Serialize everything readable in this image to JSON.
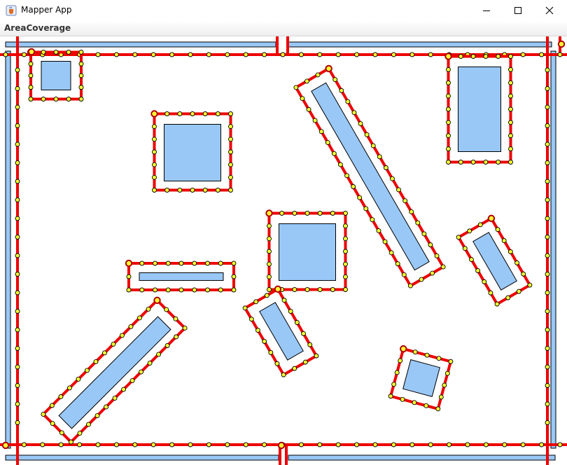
{
  "window": {
    "title": "Mapper App",
    "icon": "java-cup-icon",
    "controls": [
      "minimize-icon",
      "maximize-icon",
      "close-icon"
    ]
  },
  "menu": {
    "items": [
      "AreaCoverage"
    ]
  },
  "colors": {
    "obstacle_fill": "#99c8f7",
    "boundary_path": "#ee0000",
    "waypoint_fill": "#ffff33",
    "start_marker": "#aa0000"
  }
}
